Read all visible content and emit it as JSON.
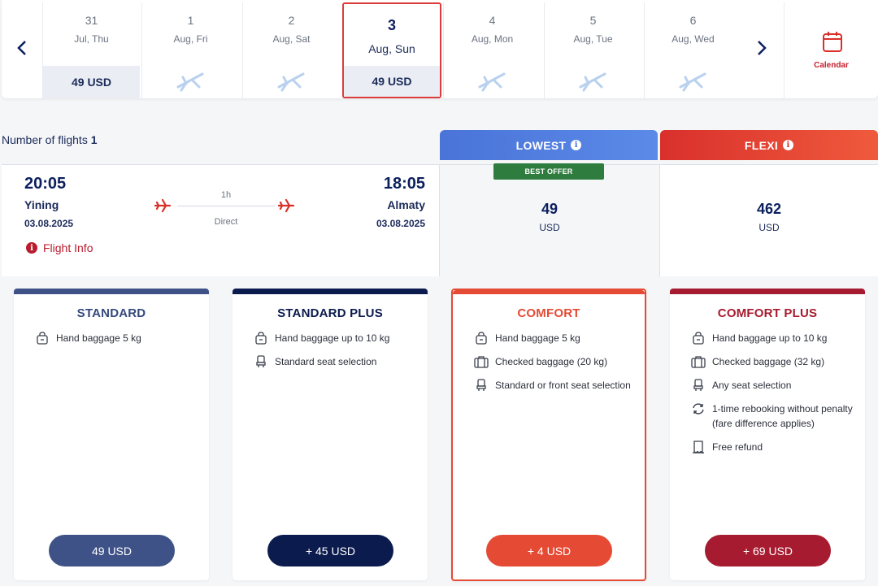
{
  "date_strip": {
    "days": [
      {
        "num": "31",
        "sub": "Jul, Thu",
        "price": "49 USD",
        "has_price": true
      },
      {
        "num": "1",
        "sub": "Aug, Fri",
        "price": "",
        "has_price": false
      },
      {
        "num": "2",
        "sub": "Aug, Sat",
        "price": "",
        "has_price": false
      },
      {
        "num": "3",
        "sub": "Aug, Sun",
        "price": "49 USD",
        "has_price": true,
        "selected": true
      },
      {
        "num": "4",
        "sub": "Aug, Mon",
        "price": "",
        "has_price": false
      },
      {
        "num": "5",
        "sub": "Aug, Tue",
        "price": "",
        "has_price": false
      },
      {
        "num": "6",
        "sub": "Aug, Wed",
        "price": "",
        "has_price": false
      }
    ],
    "calendar_label": "Calendar"
  },
  "results": {
    "num_flights_label": "Number of flights",
    "num_flights_value": "1"
  },
  "fare_headers": {
    "lowest": "LOWEST",
    "flexi": "FLEXI",
    "best_offer": "BEST OFFER"
  },
  "flight": {
    "departure_time": "20:05",
    "departure_city": "Yining",
    "departure_date": "03.08.2025",
    "arrival_time": "18:05",
    "arrival_city": "Almaty",
    "arrival_date": "03.08.2025",
    "duration": "1h",
    "stops": "Direct",
    "flight_info_label": "Flight Info",
    "lowest_price": "49",
    "lowest_currency": "USD",
    "flexi_price": "462",
    "flexi_currency": "USD"
  },
  "tiers": [
    {
      "name": "STANDARD",
      "features": [
        {
          "icon": "bag-icon",
          "text": "Hand baggage 5 kg"
        }
      ],
      "button": "49 USD",
      "color": "#3e5287"
    },
    {
      "name": "STANDARD PLUS",
      "features": [
        {
          "icon": "bag-icon",
          "text": "Hand baggage up to 10 kg"
        },
        {
          "icon": "seat-icon",
          "text": "Standard seat selection"
        }
      ],
      "button": "+ 45 USD",
      "color": "#0b1b4e"
    },
    {
      "name": "COMFORT",
      "features": [
        {
          "icon": "bag-icon",
          "text": "Hand baggage 5 kg"
        },
        {
          "icon": "suitcase-icon",
          "text": "Checked baggage (20 kg)"
        },
        {
          "icon": "seat-icon",
          "text": "Standard or front seat selection"
        }
      ],
      "button": "+ 4 USD",
      "color": "#e54a34"
    },
    {
      "name": "COMFORT PLUS",
      "features": [
        {
          "icon": "bag-icon",
          "text": "Hand baggage up to 10 kg"
        },
        {
          "icon": "suitcase-icon",
          "text": "Checked baggage (32 kg)"
        },
        {
          "icon": "seat-icon",
          "text": "Any seat selection"
        },
        {
          "icon": "rebooking-icon",
          "text": "1-time rebooking without penalty (fare difference applies)"
        },
        {
          "icon": "refund-icon",
          "text": "Free refund"
        }
      ],
      "button": "+ 69 USD",
      "color": "#a61b2f"
    }
  ]
}
